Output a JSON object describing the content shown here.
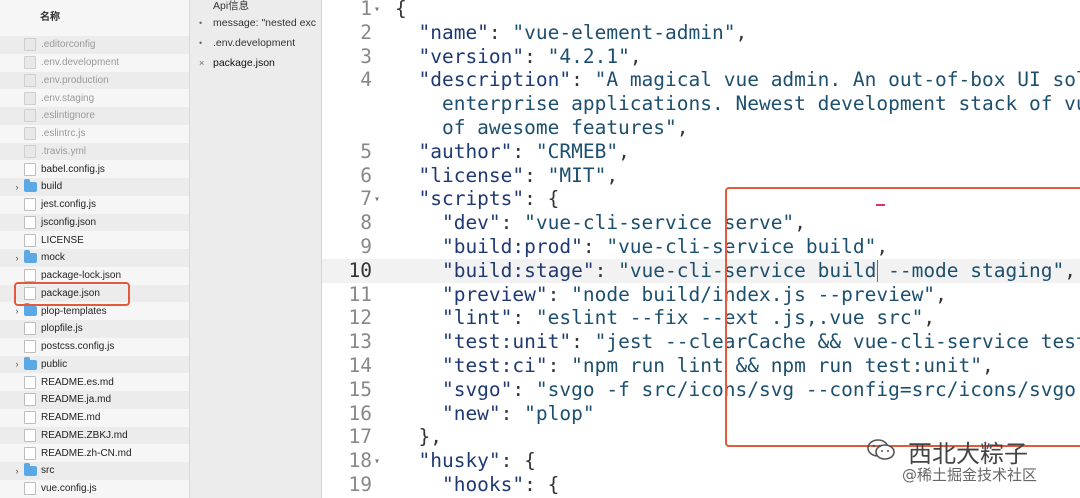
{
  "sidebar": {
    "column_header": "名称",
    "files": [
      {
        "name": ".editorconfig",
        "type": "file",
        "hidden": true,
        "expandable": false
      },
      {
        "name": ".env.development",
        "type": "file",
        "hidden": true,
        "expandable": false
      },
      {
        "name": ".env.production",
        "type": "file",
        "hidden": true,
        "expandable": false
      },
      {
        "name": ".env.staging",
        "type": "file",
        "hidden": true,
        "expandable": false
      },
      {
        "name": ".eslintignore",
        "type": "file",
        "hidden": true,
        "expandable": false
      },
      {
        "name": ".eslintrc.js",
        "type": "file",
        "hidden": true,
        "expandable": false
      },
      {
        "name": ".travis.yml",
        "type": "file",
        "hidden": true,
        "expandable": false
      },
      {
        "name": "babel.config.js",
        "type": "file",
        "hidden": false,
        "expandable": false
      },
      {
        "name": "build",
        "type": "folder",
        "hidden": false,
        "expandable": true
      },
      {
        "name": "jest.config.js",
        "type": "file",
        "hidden": false,
        "expandable": false
      },
      {
        "name": "jsconfig.json",
        "type": "file",
        "hidden": false,
        "expandable": false
      },
      {
        "name": "LICENSE",
        "type": "file",
        "hidden": false,
        "expandable": false
      },
      {
        "name": "mock",
        "type": "folder",
        "hidden": false,
        "expandable": true
      },
      {
        "name": "package-lock.json",
        "type": "file",
        "hidden": false,
        "expandable": false
      },
      {
        "name": "package.json",
        "type": "file",
        "hidden": false,
        "expandable": false,
        "highlighted": true
      },
      {
        "name": "plop-templates",
        "type": "folder",
        "hidden": false,
        "expandable": true
      },
      {
        "name": "plopfile.js",
        "type": "file",
        "hidden": false,
        "expandable": false
      },
      {
        "name": "postcss.config.js",
        "type": "file",
        "hidden": false,
        "expandable": false
      },
      {
        "name": "public",
        "type": "folder",
        "hidden": false,
        "expandable": true
      },
      {
        "name": "README.es.md",
        "type": "file",
        "hidden": false,
        "expandable": false
      },
      {
        "name": "README.ja.md",
        "type": "file",
        "hidden": false,
        "expandable": false
      },
      {
        "name": "README.md",
        "type": "file",
        "hidden": false,
        "expandable": false
      },
      {
        "name": "README.ZBKJ.md",
        "type": "file",
        "hidden": false,
        "expandable": false
      },
      {
        "name": "README.zh-CN.md",
        "type": "file",
        "hidden": false,
        "expandable": false
      },
      {
        "name": "src",
        "type": "folder",
        "hidden": false,
        "expandable": true
      },
      {
        "name": "vue.config.js",
        "type": "file",
        "hidden": false,
        "expandable": false
      }
    ]
  },
  "open_files": [
    {
      "label": "Api信息",
      "mark": "",
      "active": false
    },
    {
      "label": "message: \"nested exc",
      "mark": "•",
      "active": false
    },
    {
      "label": ".env.development",
      "mark": "•",
      "active": false
    },
    {
      "label": "package.json",
      "mark": "×",
      "active": true
    }
  ],
  "editor": {
    "current_line": 10,
    "lines": [
      {
        "n": "1",
        "fold": true,
        "segs": [
          [
            "{",
            "punc"
          ]
        ]
      },
      {
        "n": "2",
        "fold": false,
        "segs": [
          [
            "  \"name\"",
            "key"
          ],
          [
            ": ",
            "punc"
          ],
          [
            "\"vue-element-admin\"",
            "str"
          ],
          [
            ",",
            "punc"
          ]
        ]
      },
      {
        "n": "3",
        "fold": false,
        "segs": [
          [
            "  \"version\"",
            "key"
          ],
          [
            ": ",
            "punc"
          ],
          [
            "\"4.2.1\"",
            "str"
          ],
          [
            ",",
            "punc"
          ]
        ]
      },
      {
        "n": "4",
        "fold": false,
        "segs": [
          [
            "  \"description\"",
            "key"
          ],
          [
            ": ",
            "punc"
          ],
          [
            "\"A magical vue admin. An out-of-box UI sol",
            "str"
          ]
        ]
      },
      {
        "n": "",
        "fold": false,
        "segs": [
          [
            "    enterprise applications. Newest development stack of vu",
            "str"
          ]
        ]
      },
      {
        "n": "",
        "fold": false,
        "segs": [
          [
            "    of awesome features\"",
            "str"
          ],
          [
            ",",
            "punc"
          ]
        ]
      },
      {
        "n": "5",
        "fold": false,
        "segs": [
          [
            "  \"author\"",
            "key"
          ],
          [
            ": ",
            "punc"
          ],
          [
            "\"CRMEB\"",
            "str"
          ],
          [
            ",",
            "punc"
          ]
        ]
      },
      {
        "n": "6",
        "fold": false,
        "segs": [
          [
            "  \"license\"",
            "key"
          ],
          [
            ": ",
            "punc"
          ],
          [
            "\"MIT\"",
            "str"
          ],
          [
            ",",
            "punc"
          ]
        ]
      },
      {
        "n": "7",
        "fold": true,
        "segs": [
          [
            "  \"scripts\"",
            "key"
          ],
          [
            ": {",
            "punc"
          ]
        ]
      },
      {
        "n": "8",
        "fold": false,
        "segs": [
          [
            "    \"dev\"",
            "key"
          ],
          [
            ": ",
            "punc"
          ],
          [
            "\"vue-cli-service serve\"",
            "str"
          ],
          [
            ",",
            "punc"
          ]
        ]
      },
      {
        "n": "9",
        "fold": false,
        "segs": [
          [
            "    \"build:prod\"",
            "key"
          ],
          [
            ": ",
            "punc"
          ],
          [
            "\"vue-cli-service build\"",
            "str"
          ],
          [
            ",",
            "punc"
          ]
        ]
      },
      {
        "n": "10",
        "fold": false,
        "segs": [
          [
            "    \"build:stage\"",
            "key"
          ],
          [
            ": ",
            "punc"
          ],
          [
            "\"vue-cli-service build --mode staging\"",
            "str"
          ],
          [
            ",",
            "punc"
          ]
        ]
      },
      {
        "n": "11",
        "fold": false,
        "segs": [
          [
            "    \"preview\"",
            "key"
          ],
          [
            ": ",
            "punc"
          ],
          [
            "\"node build/index.js --preview\"",
            "str"
          ],
          [
            ",",
            "punc"
          ]
        ]
      },
      {
        "n": "12",
        "fold": false,
        "segs": [
          [
            "    \"lint\"",
            "key"
          ],
          [
            ": ",
            "punc"
          ],
          [
            "\"eslint --fix --ext .js,.vue src\"",
            "str"
          ],
          [
            ",",
            "punc"
          ]
        ]
      },
      {
        "n": "13",
        "fold": false,
        "segs": [
          [
            "    \"test:unit\"",
            "key"
          ],
          [
            ": ",
            "punc"
          ],
          [
            "\"jest --clearCache && vue-cli-service test",
            "str"
          ]
        ]
      },
      {
        "n": "14",
        "fold": false,
        "segs": [
          [
            "    \"test:ci\"",
            "key"
          ],
          [
            ": ",
            "punc"
          ],
          [
            "\"npm run lint && npm run test:unit\"",
            "str"
          ],
          [
            ",",
            "punc"
          ]
        ]
      },
      {
        "n": "15",
        "fold": false,
        "segs": [
          [
            "    \"svgo\"",
            "key"
          ],
          [
            ": ",
            "punc"
          ],
          [
            "\"svgo -f src/icons/svg --config=src/icons/svgo.",
            "str"
          ]
        ]
      },
      {
        "n": "16",
        "fold": false,
        "segs": [
          [
            "    \"new\"",
            "key"
          ],
          [
            ": ",
            "punc"
          ],
          [
            "\"plop\"",
            "str"
          ]
        ]
      },
      {
        "n": "17",
        "fold": false,
        "segs": [
          [
            "  },",
            "punc"
          ]
        ]
      },
      {
        "n": "18",
        "fold": true,
        "segs": [
          [
            "  \"husky\"",
            "key"
          ],
          [
            ": {",
            "punc"
          ]
        ]
      },
      {
        "n": "19",
        "fold": false,
        "segs": [
          [
            "    \"hooks\"",
            "key"
          ],
          [
            ": {",
            "punc"
          ]
        ]
      }
    ]
  },
  "watermark": {
    "title": "西北大粽子",
    "subtitle": "@稀土掘金技术社区"
  },
  "colors": {
    "highlight_box": "#e25a3c",
    "folder": "#5aa9e6",
    "caret": "#e0307a"
  }
}
